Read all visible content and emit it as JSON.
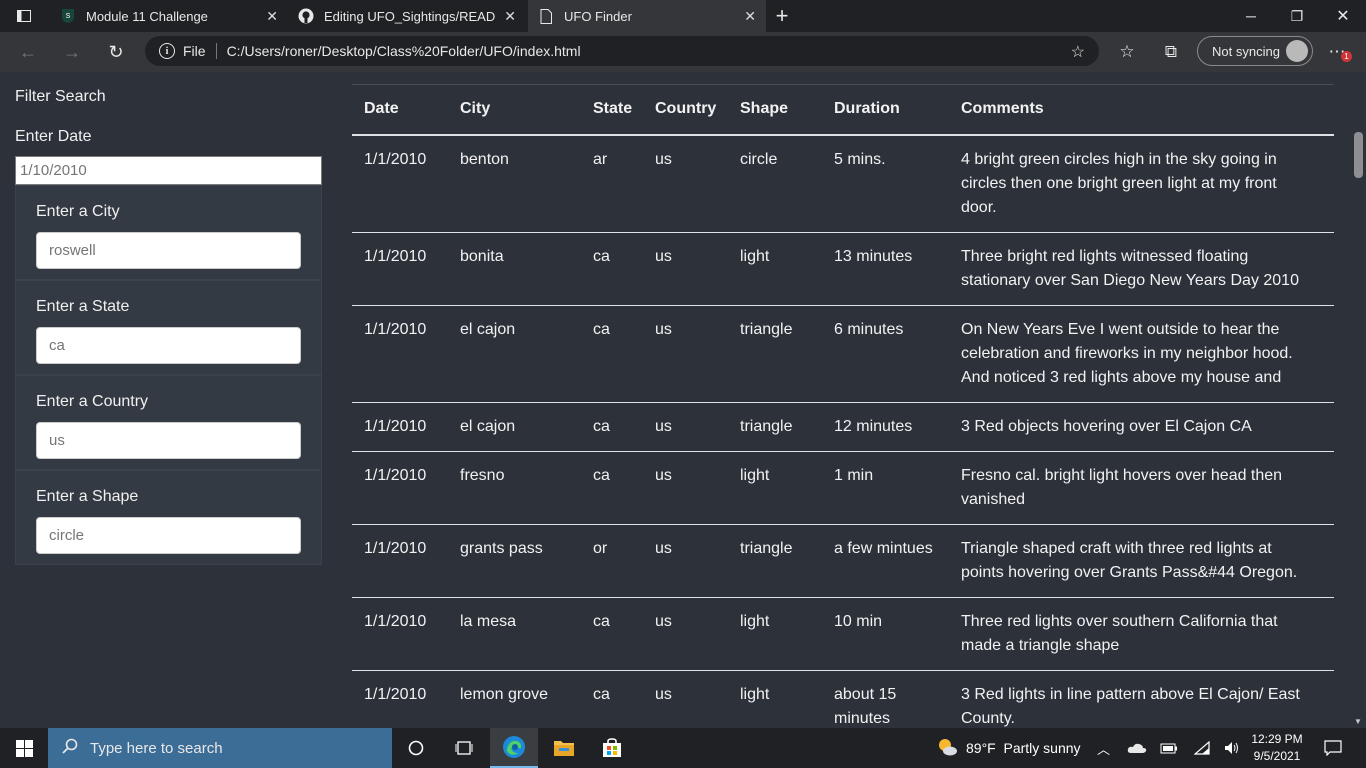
{
  "browser": {
    "tabs": [
      {
        "title": "Module 11 Challenge"
      },
      {
        "title": "Editing UFO_Sightings/README.md"
      },
      {
        "title": "UFO Finder"
      }
    ],
    "address": {
      "scheme_label": "File",
      "url": "C:/Users/roner/Desktop/Class%20Folder/UFO/index.html"
    },
    "sync_label": "Not syncing",
    "notification_count": "1"
  },
  "filters": {
    "title": "Filter Search",
    "date": {
      "label": "Enter Date",
      "placeholder": "1/10/2010"
    },
    "city": {
      "label": "Enter a City",
      "placeholder": "roswell"
    },
    "state": {
      "label": "Enter a State",
      "placeholder": "ca"
    },
    "country": {
      "label": "Enter a Country",
      "placeholder": "us"
    },
    "shape": {
      "label": "Enter a Shape",
      "placeholder": "circle"
    }
  },
  "table": {
    "headers": [
      "Date",
      "City",
      "State",
      "Country",
      "Shape",
      "Duration",
      "Comments"
    ],
    "rows": [
      [
        "1/1/2010",
        "benton",
        "ar",
        "us",
        "circle",
        "5 mins.",
        "4 bright green circles high in the sky going in circles then one bright green light at my front door."
      ],
      [
        "1/1/2010",
        "bonita",
        "ca",
        "us",
        "light",
        "13 minutes",
        "Three bright red lights witnessed floating stationary over San Diego New Years Day 2010"
      ],
      [
        "1/1/2010",
        "el cajon",
        "ca",
        "us",
        "triangle",
        "6 minutes",
        "On New Years Eve I went outside to hear the celebration and fireworks in my neighbor hood. And noticed 3 red lights above my house and"
      ],
      [
        "1/1/2010",
        "el cajon",
        "ca",
        "us",
        "triangle",
        "12 minutes",
        "3 Red objects hovering over El Cajon CA"
      ],
      [
        "1/1/2010",
        "fresno",
        "ca",
        "us",
        "light",
        "1 min",
        "Fresno cal. bright light hovers over head then vanished"
      ],
      [
        "1/1/2010",
        "grants pass",
        "or",
        "us",
        "triangle",
        "a few mintues",
        "Triangle shaped craft with three red lights at points hovering over Grants Pass&#44 Oregon."
      ],
      [
        "1/1/2010",
        "la mesa",
        "ca",
        "us",
        "light",
        "10 min",
        "Three red lights over southern California that made a triangle shape"
      ],
      [
        "1/1/2010",
        "lemon grove",
        "ca",
        "us",
        "light",
        "about 15 minutes",
        "3 Red lights in line pattern above El Cajon/ East County."
      ]
    ]
  },
  "taskbar": {
    "search_placeholder": "Type here to search",
    "weather": "89°F  Partly sunny",
    "time": "12:29 PM",
    "date": "9/5/2021"
  }
}
